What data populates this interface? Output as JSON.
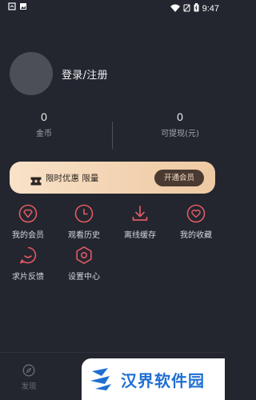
{
  "status_bar": {
    "time": "9:47",
    "icons": [
      "notification-icon",
      "image-icon",
      "wifi-icon",
      "silent-icon",
      "battery-icon"
    ]
  },
  "profile": {
    "login_label": "登录/注册"
  },
  "stats": {
    "coins_value": "0",
    "coins_label": "金币",
    "cash_value": "0",
    "cash_label": "可提现(元)"
  },
  "vip_banner": {
    "text": "限时优惠 限量",
    "button_label": "开通会员",
    "colors": {
      "gradient_start": "#f8e2c8",
      "gradient_end": "#eec9a3",
      "button_bg": "#4a3a32"
    }
  },
  "menu": {
    "accent_color": "#e05a63",
    "items": [
      {
        "label": "我的会员",
        "icon": "diamond-icon"
      },
      {
        "label": "观看历史",
        "icon": "clock-icon"
      },
      {
        "label": "离线缓存",
        "icon": "download-icon"
      },
      {
        "label": "我的收藏",
        "icon": "heart-icon"
      },
      {
        "label": "求片反馈",
        "icon": "chat-icon"
      },
      {
        "label": "设置中心",
        "icon": "settings-icon"
      }
    ]
  },
  "bottom_nav": {
    "tabs": [
      {
        "label": "发现",
        "icon": "compass-icon"
      }
    ]
  },
  "watermark": {
    "text": "汉界软件园"
  }
}
